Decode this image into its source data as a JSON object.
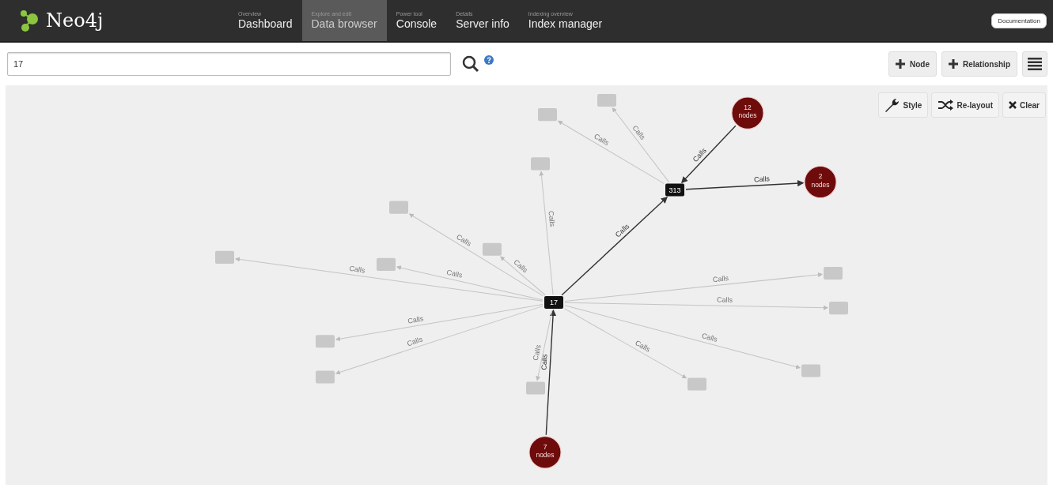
{
  "header": {
    "logo": "Neo4j",
    "tabs": [
      {
        "subtitle": "Overview",
        "label": "Dashboard",
        "selected": false
      },
      {
        "subtitle": "Explore and edit",
        "label": "Data browser",
        "selected": true
      },
      {
        "subtitle": "Power tool",
        "label": "Console",
        "selected": false
      },
      {
        "subtitle": "Details",
        "label": "Server info",
        "selected": false
      },
      {
        "subtitle": "Indexing overview",
        "label": "Index manager",
        "selected": false
      }
    ],
    "documentation_button": "Documentation"
  },
  "search": {
    "value": "17"
  },
  "toolbar_buttons": [
    {
      "label": "Node",
      "kind": "plus"
    },
    {
      "label": "Relationship",
      "kind": "plus"
    },
    {
      "kind": "menu"
    }
  ],
  "graph_buttons": [
    {
      "label": "Style",
      "kind": "style"
    },
    {
      "label": "Re-layout",
      "kind": "relayout"
    },
    {
      "label": "Clear",
      "kind": "clear"
    }
  ],
  "graph": {
    "nodes": [
      {
        "label": "17",
        "kind": "node"
      },
      {
        "label": "313",
        "kind": "node"
      },
      {
        "label": "12\nnodes",
        "kind": "group"
      },
      {
        "label": "2\nnodes",
        "kind": "group"
      },
      {
        "label": "7\nnodes",
        "kind": "group"
      },
      {
        "kind": "faded"
      },
      {
        "kind": "faded"
      },
      {
        "kind": "faded"
      },
      {
        "kind": "faded"
      },
      {
        "kind": "faded"
      },
      {
        "kind": "faded"
      },
      {
        "kind": "faded"
      },
      {
        "kind": "faded"
      },
      {
        "kind": "faded"
      },
      {
        "kind": "faded"
      },
      {
        "kind": "faded"
      },
      {
        "kind": "faded"
      },
      {
        "kind": "faded"
      },
      {
        "kind": "faded"
      }
    ],
    "edges": [
      {
        "label": "Calls",
        "kind": "active"
      },
      {
        "label": "Calls",
        "kind": "active"
      },
      {
        "label": "Calls",
        "kind": "active"
      },
      {
        "label": "Calls",
        "kind": "active"
      },
      {
        "label": "Calls",
        "kind": "faded"
      },
      {
        "label": "Calls",
        "kind": "faded"
      },
      {
        "label": "Calls",
        "kind": "faded"
      },
      {
        "label": "Calls",
        "kind": "faded"
      },
      {
        "label": "Calls",
        "kind": "faded"
      },
      {
        "label": "Calls",
        "kind": "faded"
      },
      {
        "label": "Calls",
        "kind": "faded"
      },
      {
        "label": "Calls",
        "kind": "faded"
      },
      {
        "label": "Calls",
        "kind": "faded"
      },
      {
        "label": "Calls",
        "kind": "faded"
      },
      {
        "label": "Calls",
        "kind": "faded"
      },
      {
        "label": "Calls",
        "kind": "faded"
      },
      {
        "label": "Calls",
        "kind": "faded"
      },
      {
        "label": "Calls",
        "kind": "faded"
      }
    ]
  }
}
